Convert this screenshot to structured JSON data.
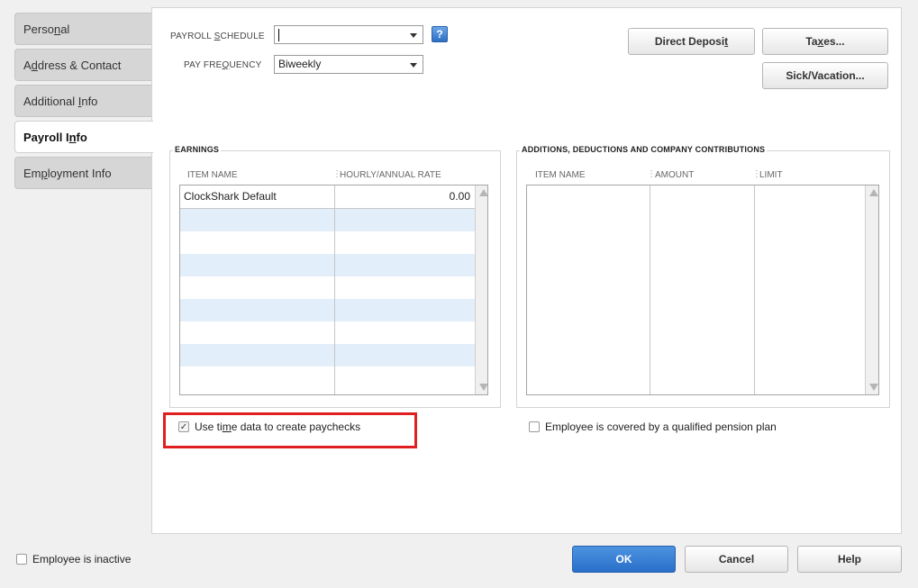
{
  "tabs": [
    {
      "label": "Personal"
    },
    {
      "label": "Address & Contact"
    },
    {
      "label": "Additional Info"
    },
    {
      "label": "Payroll Info"
    },
    {
      "label": "Employment Info"
    }
  ],
  "payroll_schedule": {
    "label": "PAYROLL SCHEDULE",
    "value": "",
    "help": "?"
  },
  "pay_frequency": {
    "label": "PAY FREQUENCY",
    "value": "Biweekly"
  },
  "buttons": {
    "direct_deposit": "Direct Deposit",
    "taxes": "Taxes...",
    "sick_vacation": "Sick/Vacation..."
  },
  "earnings": {
    "title": "EARNINGS",
    "columns": [
      "ITEM NAME",
      "HOURLY/ANNUAL RATE"
    ],
    "rows": [
      {
        "item": "ClockShark Default",
        "rate": "0.00"
      }
    ]
  },
  "additions": {
    "title": "ADDITIONS, DEDUCTIONS AND COMPANY CONTRIBUTIONS",
    "columns": [
      "ITEM NAME",
      "AMOUNT",
      "LIMIT"
    ]
  },
  "checkboxes": {
    "use_time_data": {
      "label": "Use time data to create paychecks",
      "checked": true
    },
    "pension_plan": {
      "label": "Employee is covered by a qualified pension plan",
      "checked": false
    },
    "inactive": {
      "label": "Employee is inactive",
      "checked": false
    }
  },
  "footer": {
    "ok": "OK",
    "cancel": "Cancel",
    "help": "Help"
  },
  "colors": {
    "highlight_box": "#e02020",
    "primary_button": "#2a6fc9",
    "row_alt": "#e3eefb"
  }
}
